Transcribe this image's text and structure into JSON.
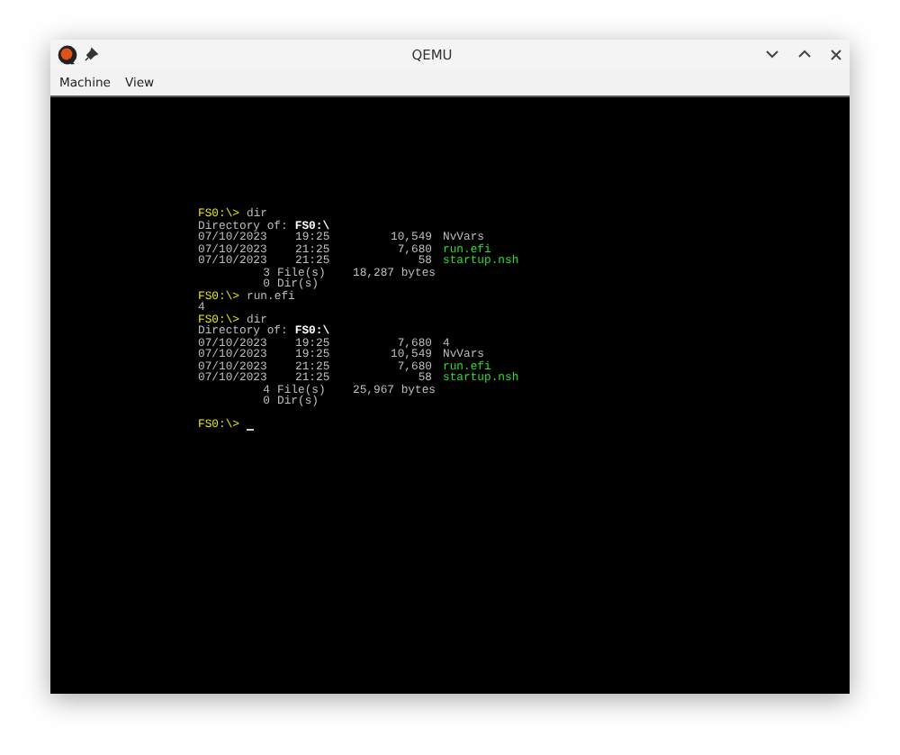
{
  "window": {
    "title": "QEMU"
  },
  "menu": [
    "Machine",
    "View"
  ],
  "console": [
    {
      "kind": "prompt",
      "prompt": "FS0:\\>",
      "command": "dir",
      "cursor": false
    },
    {
      "kind": "header",
      "label": "Directory of:",
      "path": "FS0:\\"
    },
    {
      "kind": "entry",
      "date": "07/10/2023",
      "time": "19:25",
      "size": "10,549",
      "name": "NvVars",
      "executable": false
    },
    {
      "kind": "entry",
      "date": "07/10/2023",
      "time": "21:25",
      "size": "7,680",
      "name": "run.efi",
      "executable": true
    },
    {
      "kind": "entry",
      "date": "07/10/2023",
      "time": "21:25",
      "size": "58",
      "name": "startup.nsh",
      "executable": true
    },
    {
      "kind": "summary",
      "count": "3",
      "label": "File(s)",
      "total": "18,287 bytes"
    },
    {
      "kind": "summary",
      "count": "0",
      "label": "Dir(s)"
    },
    {
      "kind": "prompt",
      "prompt": "FS0:\\>",
      "command": "run.efi",
      "cursor": false
    },
    {
      "kind": "output",
      "text": "4"
    },
    {
      "kind": "prompt",
      "prompt": "FS0:\\>",
      "command": "dir",
      "cursor": false
    },
    {
      "kind": "header",
      "label": "Directory of:",
      "path": "FS0:\\"
    },
    {
      "kind": "entry",
      "date": "07/10/2023",
      "time": "19:25",
      "size": "7,680",
      "name": "4",
      "executable": false
    },
    {
      "kind": "entry",
      "date": "07/10/2023",
      "time": "19:25",
      "size": "10,549",
      "name": "NvVars",
      "executable": false
    },
    {
      "kind": "entry",
      "date": "07/10/2023",
      "time": "21:25",
      "size": "7,680",
      "name": "run.efi",
      "executable": true
    },
    {
      "kind": "entry",
      "date": "07/10/2023",
      "time": "21:25",
      "size": "58",
      "name": "startup.nsh",
      "executable": true
    },
    {
      "kind": "summary",
      "count": "4",
      "label": "File(s)",
      "total": "25,967 bytes"
    },
    {
      "kind": "summary",
      "count": "0",
      "label": "Dir(s)"
    },
    {
      "kind": "blank"
    },
    {
      "kind": "prompt",
      "prompt": "FS0:\\>",
      "cursor": true
    }
  ]
}
